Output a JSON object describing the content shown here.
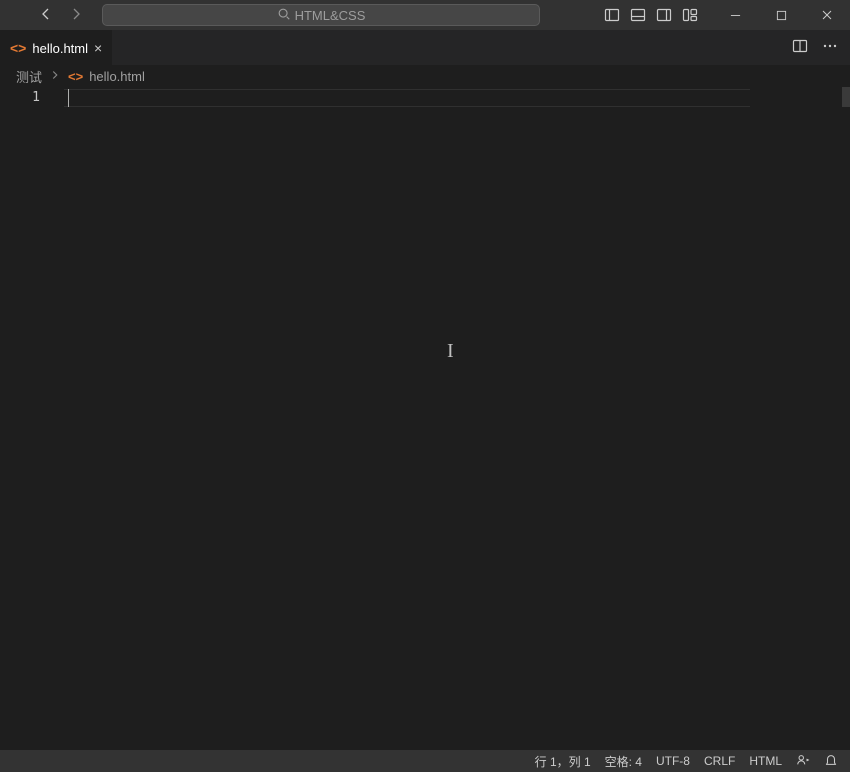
{
  "command_center": {
    "label": "HTML&CSS"
  },
  "tab": {
    "filename": "hello.html"
  },
  "breadcrumb": {
    "folder": "测试",
    "file": "hello.html"
  },
  "editor": {
    "line_numbers": [
      "1"
    ]
  },
  "statusbar": {
    "position": "行 1，列 1",
    "indent": "空格: 4",
    "encoding": "UTF-8",
    "eol": "CRLF",
    "language": "HTML"
  }
}
